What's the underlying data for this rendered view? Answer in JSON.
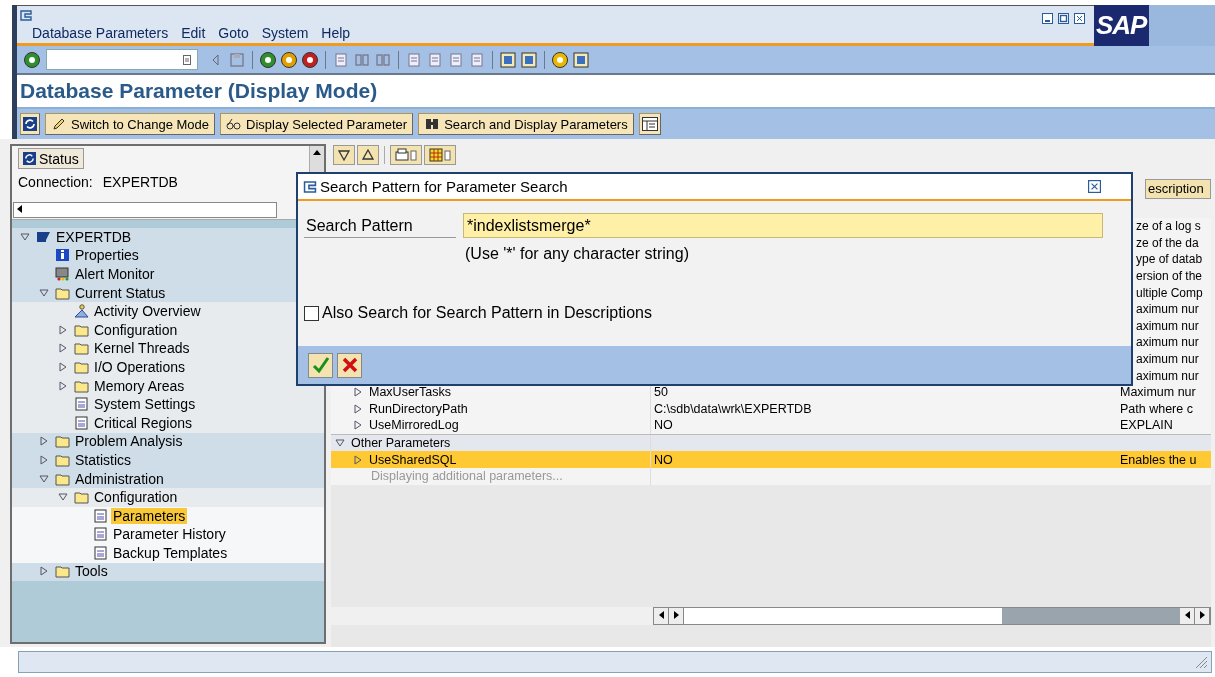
{
  "window": {
    "logo": "SAP",
    "menu": [
      {
        "label": "Database Parameters"
      },
      {
        "label": "Edit"
      },
      {
        "label": "Goto"
      },
      {
        "label": "System"
      },
      {
        "label": "Help"
      }
    ]
  },
  "title": "Database Parameter (Display Mode)",
  "app_toolbar": {
    "buttons": [
      {
        "label": "Switch to Change Mode",
        "kind": "pencil"
      },
      {
        "label": "Display Selected Parameter",
        "kind": "glasses"
      },
      {
        "label": "Search and Display Parameters",
        "kind": "binoculars"
      }
    ]
  },
  "status_panel": {
    "button": "Status",
    "connection_label": "Connection:",
    "connection_value": "EXPERTDB"
  },
  "tree": [
    {
      "label": "EXPERTDB",
      "kind": "database",
      "expanded": true,
      "selected": false,
      "children": [
        {
          "label": "Properties",
          "kind": "info",
          "selected": false
        },
        {
          "label": "Alert Monitor",
          "kind": "monitor",
          "selected": false
        },
        {
          "label": "Current Status",
          "kind": "folder",
          "expanded": true,
          "selected": false,
          "children": [
            {
              "label": "Activity Overview",
              "kind": "activity",
              "selected": false
            },
            {
              "label": "Configuration",
              "kind": "folder",
              "expanded": false,
              "selected": false
            },
            {
              "label": "Kernel Threads",
              "kind": "folder",
              "expanded": false,
              "selected": false
            },
            {
              "label": "I/O Operations",
              "kind": "folder",
              "expanded": false,
              "selected": false
            },
            {
              "label": "Memory Areas",
              "kind": "folder",
              "expanded": false,
              "selected": false
            },
            {
              "label": "System Settings",
              "kind": "document",
              "selected": false
            },
            {
              "label": "Critical Regions",
              "kind": "document",
              "selected": false
            }
          ]
        },
        {
          "label": "Problem Analysis",
          "kind": "folder",
          "expanded": false,
          "selected": false
        },
        {
          "label": "Statistics",
          "kind": "folder",
          "expanded": false,
          "selected": false
        },
        {
          "label": "Administration",
          "kind": "folder",
          "expanded": true,
          "selected": false,
          "children": [
            {
              "label": "Configuration",
              "kind": "folder",
              "expanded": true,
              "selected": false,
              "children": [
                {
                  "label": "Parameters",
                  "kind": "document",
                  "selected": true
                },
                {
                  "label": "Parameter History",
                  "kind": "document",
                  "selected": false
                },
                {
                  "label": "Backup Templates",
                  "kind": "document",
                  "selected": false
                }
              ]
            }
          ]
        },
        {
          "label": "Tools",
          "kind": "folder",
          "expanded": false,
          "selected": false
        }
      ]
    }
  ],
  "table": {
    "column_3_header": "escription",
    "rows": [
      {
        "kind": "partial",
        "description": "ze of a log s"
      },
      {
        "kind": "partial",
        "description": "ze of the da"
      },
      {
        "kind": "partial",
        "description": "ype of datab"
      },
      {
        "kind": "partial",
        "description": "ersion of the"
      },
      {
        "kind": "partial",
        "description": "ultiple Comp"
      },
      {
        "kind": "partial",
        "description": "aximum nur"
      },
      {
        "kind": "partial",
        "description": "aximum nur"
      },
      {
        "kind": "partial",
        "description": "aximum nur"
      },
      {
        "kind": "partial",
        "description": "aximum nur"
      },
      {
        "kind": "partial",
        "description": "aximum nur"
      },
      {
        "kind": "param",
        "name": "MaxUserTasks",
        "value": "50",
        "description": "Maximum nur",
        "expanded": false,
        "selected": false
      },
      {
        "kind": "param",
        "name": "RunDirectoryPath",
        "value": "C:\\sdb\\data\\wrk\\EXPERTDB",
        "description": "Path where c",
        "expanded": false,
        "selected": false
      },
      {
        "kind": "param",
        "name": "UseMirroredLog",
        "value": "NO",
        "description": "EXPLAIN",
        "expanded": false,
        "selected": false
      },
      {
        "kind": "group",
        "name": "Other Parameters",
        "expanded": true
      },
      {
        "kind": "param",
        "name": "UseSharedSQL",
        "value": "NO",
        "description": "Enables the u",
        "expanded": false,
        "selected": true
      },
      {
        "kind": "note",
        "name": "Displaying additional parameters..."
      }
    ]
  },
  "dialog": {
    "title": "Search Pattern for Parameter Search",
    "field_label": "Search Pattern",
    "value": "*indexlistsmerge*",
    "hint": "(Use '*' for any character string)",
    "checkbox": {
      "label": "Also Search for Search Pattern in Descriptions",
      "checked": false
    }
  }
}
